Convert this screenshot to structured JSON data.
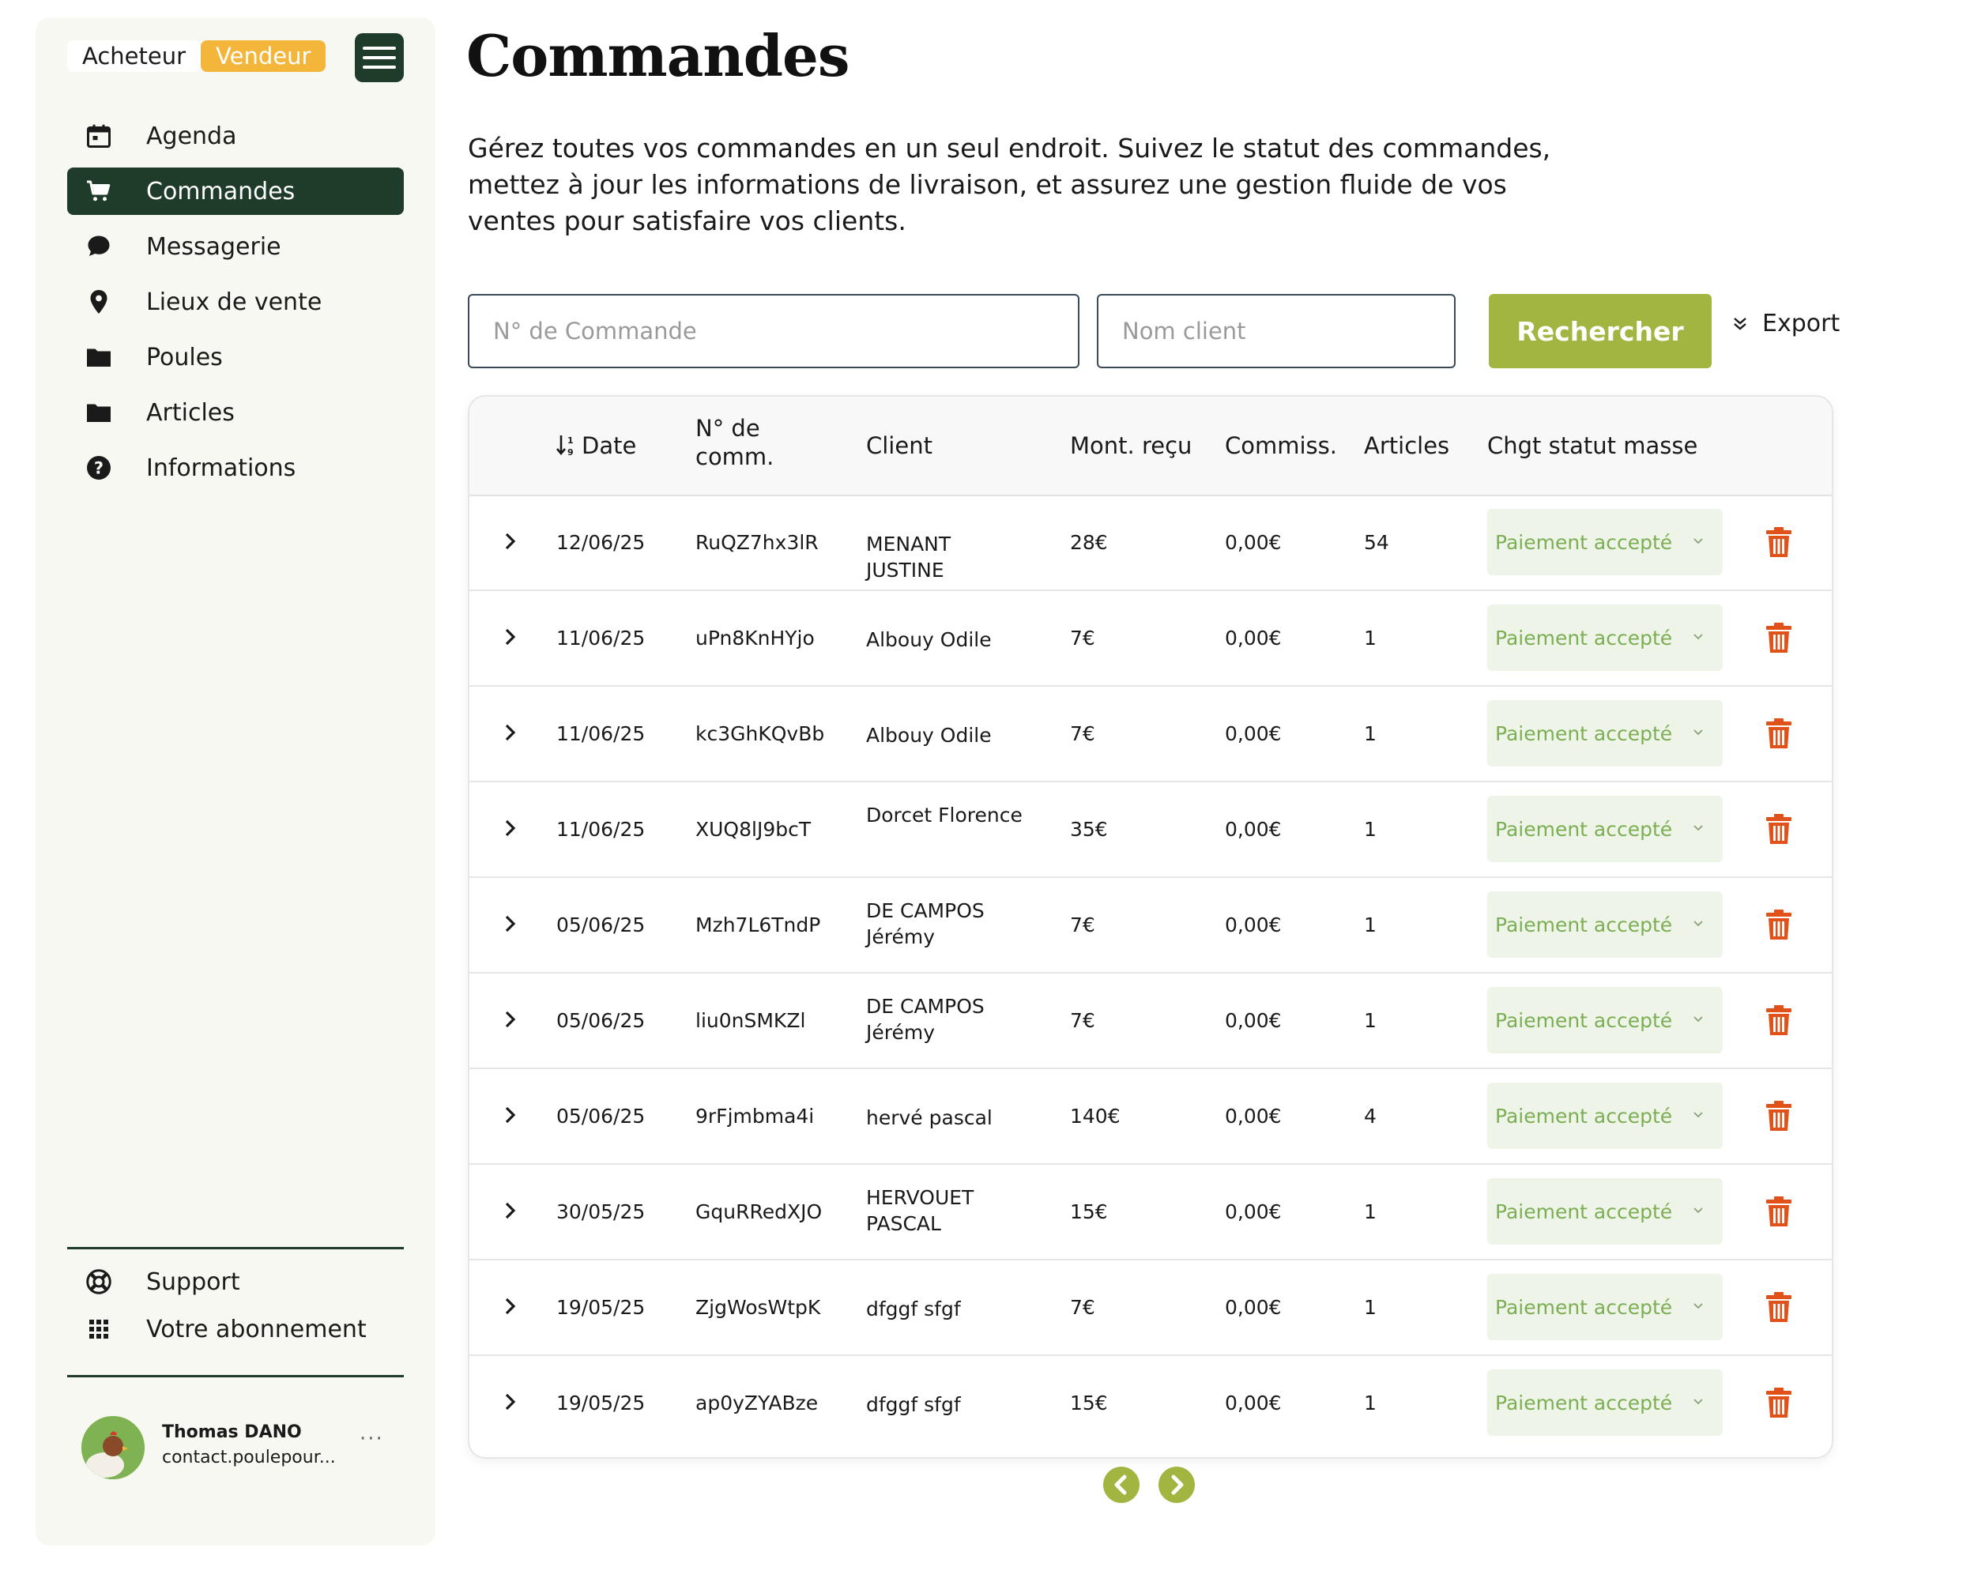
{
  "sidebar": {
    "role_buyer": "Acheteur",
    "role_seller": "Vendeur",
    "menu_icon": "hamburger-menu-icon",
    "items": [
      {
        "label": "Agenda",
        "icon": "calendar-icon"
      },
      {
        "label": "Commandes",
        "icon": "cart-icon",
        "active": true
      },
      {
        "label": "Messagerie",
        "icon": "chat-bubble-icon"
      },
      {
        "label": "Lieux de vente",
        "icon": "map-pin-icon"
      },
      {
        "label": "Poules",
        "icon": "folder-icon"
      },
      {
        "label": "Articles",
        "icon": "folder-icon"
      },
      {
        "label": "Informations",
        "icon": "help-circle-icon"
      }
    ],
    "bottom_items": [
      {
        "label": "Support",
        "icon": "lifebuoy-icon"
      },
      {
        "label": "Votre abonnement",
        "icon": "grid-icon"
      }
    ],
    "profile": {
      "name": "Thomas DANO",
      "email": "contact.poulepour...",
      "more": "···"
    }
  },
  "page": {
    "title": "Commandes",
    "description": "Gérez toutes vos commandes en un seul endroit. Suivez le statut des commandes, mettez à jour les informations de livraison, et assurez une gestion fluide de vos ventes pour satisfaire vos clients."
  },
  "search": {
    "order_placeholder": "N° de Commande",
    "order_value": "",
    "client_placeholder": "Nom client",
    "client_value": "",
    "button_label": "Rechercher",
    "export_label": "Export"
  },
  "table": {
    "headers": {
      "date": "Date",
      "order_number": "N° de comm.",
      "client": "Client",
      "amount": "Mont. reçu",
      "commission": "Commiss.",
      "articles": "Articles",
      "bulk_status": "Chgt statut masse"
    },
    "rows": [
      {
        "date": "12/06/25",
        "number": "RuQZ7hx3lR",
        "client": "MENANT JUSTINE",
        "amount": "28€",
        "commission": "0,00€",
        "articles": "54",
        "status": "Paiement accepté"
      },
      {
        "date": "11/06/25",
        "number": "uPn8KnHYjo",
        "client": "Albouy Odile",
        "amount": "7€",
        "commission": "0,00€",
        "articles": "1",
        "status": "Paiement accepté"
      },
      {
        "date": "11/06/25",
        "number": "kc3GhKQvBb",
        "client": "Albouy Odile",
        "amount": "7€",
        "commission": "0,00€",
        "articles": "1",
        "status": "Paiement accepté"
      },
      {
        "date": "11/06/25",
        "number": "XUQ8lJ9bcT",
        "client": "Dorcet  Florence",
        "amount": "35€",
        "commission": "0,00€",
        "articles": "1",
        "status": "Paiement accepté"
      },
      {
        "date": "05/06/25",
        "number": "Mzh7L6TndP",
        "client": "DE CAMPOS Jérémy",
        "amount": "7€",
        "commission": "0,00€",
        "articles": "1",
        "status": "Paiement accepté"
      },
      {
        "date": "05/06/25",
        "number": "liu0nSMKZl",
        "client": "DE CAMPOS Jérémy",
        "amount": "7€",
        "commission": "0,00€",
        "articles": "1",
        "status": "Paiement accepté"
      },
      {
        "date": "05/06/25",
        "number": "9rFjmbma4i",
        "client": "hervé pascal",
        "amount": "140€",
        "commission": "0,00€",
        "articles": "4",
        "status": "Paiement accepté"
      },
      {
        "date": "30/05/25",
        "number": "GquRRedXJO",
        "client": "HERVOUET PASCAL",
        "amount": "15€",
        "commission": "0,00€",
        "articles": "1",
        "status": "Paiement accepté"
      },
      {
        "date": "19/05/25",
        "number": "ZjgWosWtpK",
        "client": "dfggf sfgf",
        "amount": "7€",
        "commission": "0,00€",
        "articles": "1",
        "status": "Paiement accepté"
      },
      {
        "date": "19/05/25",
        "number": "ap0yZYABze",
        "client": "dfggf sfgf",
        "amount": "15€",
        "commission": "0,00€",
        "articles": "1",
        "status": "Paiement accepté"
      }
    ]
  },
  "pagination": {
    "prev_icon": "chevron-left-circle-icon",
    "next_icon": "chevron-right-circle-icon"
  },
  "colors": {
    "brand_dark": "#1f3b2a",
    "seller_accent": "#f3b53a",
    "search_button": "#a2b541",
    "status_text": "#7cae54",
    "status_bg": "#eef5e8",
    "trash": "#e0521a"
  }
}
